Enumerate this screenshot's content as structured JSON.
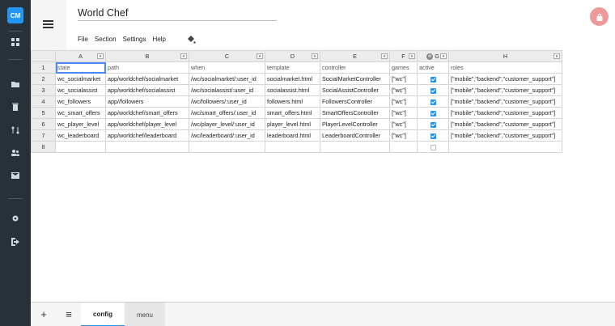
{
  "app": {
    "logo_text": "CM",
    "title": "World Chef",
    "accent": "#2196f3",
    "lock_color": "#ef9a9a"
  },
  "menubar": [
    "File",
    "Section",
    "Settings",
    "Help"
  ],
  "rail_icons": [
    "dashboard-icon",
    "folder-icon",
    "trash-icon",
    "merge-icon",
    "users-icon",
    "mail-icon",
    "settings-icon",
    "logout-icon"
  ],
  "grid": {
    "columns": [
      {
        "letter": "A"
      },
      {
        "letter": "B"
      },
      {
        "letter": "C"
      },
      {
        "letter": "D"
      },
      {
        "letter": "E"
      },
      {
        "letter": "F"
      },
      {
        "letter": "G"
      },
      {
        "letter": "H"
      }
    ],
    "header_row": [
      "state",
      "path",
      "when",
      "template",
      "controller",
      "games",
      "active",
      "roles"
    ],
    "rows": [
      [
        "wc_socialmarket",
        "app/worldchef/socialmarket",
        "/wc/socialmarket/:user_id",
        "socialmarket.html",
        "SocialMarketController",
        "[\"wc\"]",
        "on",
        "[\"mobile\",\"backend\",\"customer_support\"]"
      ],
      [
        "wc_socialassist",
        "app/worldchef/socialassist",
        "/wc/socialassist/:user_id",
        "socialassist.html",
        "SocialAssistController",
        "[\"wc\"]",
        "on",
        "[\"mobile\",\"backend\",\"customer_support\"]"
      ],
      [
        "wc_followers",
        "app//followers",
        "/wc/followers/:user_id",
        "followers.html",
        "FollowersController",
        "[\"wc\"]",
        "on",
        "[\"mobile\",\"backend\",\"customer_support\"]"
      ],
      [
        "wc_smart_offers",
        "app/worldchef/smart_offers",
        "/wc/smart_offers/:user_id",
        "smart_offers.html",
        "SmartOffersController",
        "[\"wc\"]",
        "on",
        "[\"mobile\",\"backend\",\"customer_support\"]"
      ],
      [
        "wc_player_level",
        "app/worldchef/player_level",
        "/wc/player_level/:user_id",
        "player_level.html",
        "PlayerLevelController",
        "[\"wc\"]",
        "on",
        "[\"mobile\",\"backend\",\"customer_support\"]"
      ],
      [
        "wc_leaderboard",
        "app/worldchef/leaderboard",
        "/wc/leaderboard/:user_id",
        "leaderboard.html",
        "LeaderboardController",
        "[\"wc\"]",
        "on",
        "[\"mobile\",\"backend\",\"customer_support\"]"
      ],
      [
        "",
        "",
        "",
        "",
        "",
        "",
        "off",
        ""
      ]
    ]
  },
  "tabs": {
    "add": "+",
    "list": "≡",
    "items": [
      "config",
      "menu"
    ]
  }
}
